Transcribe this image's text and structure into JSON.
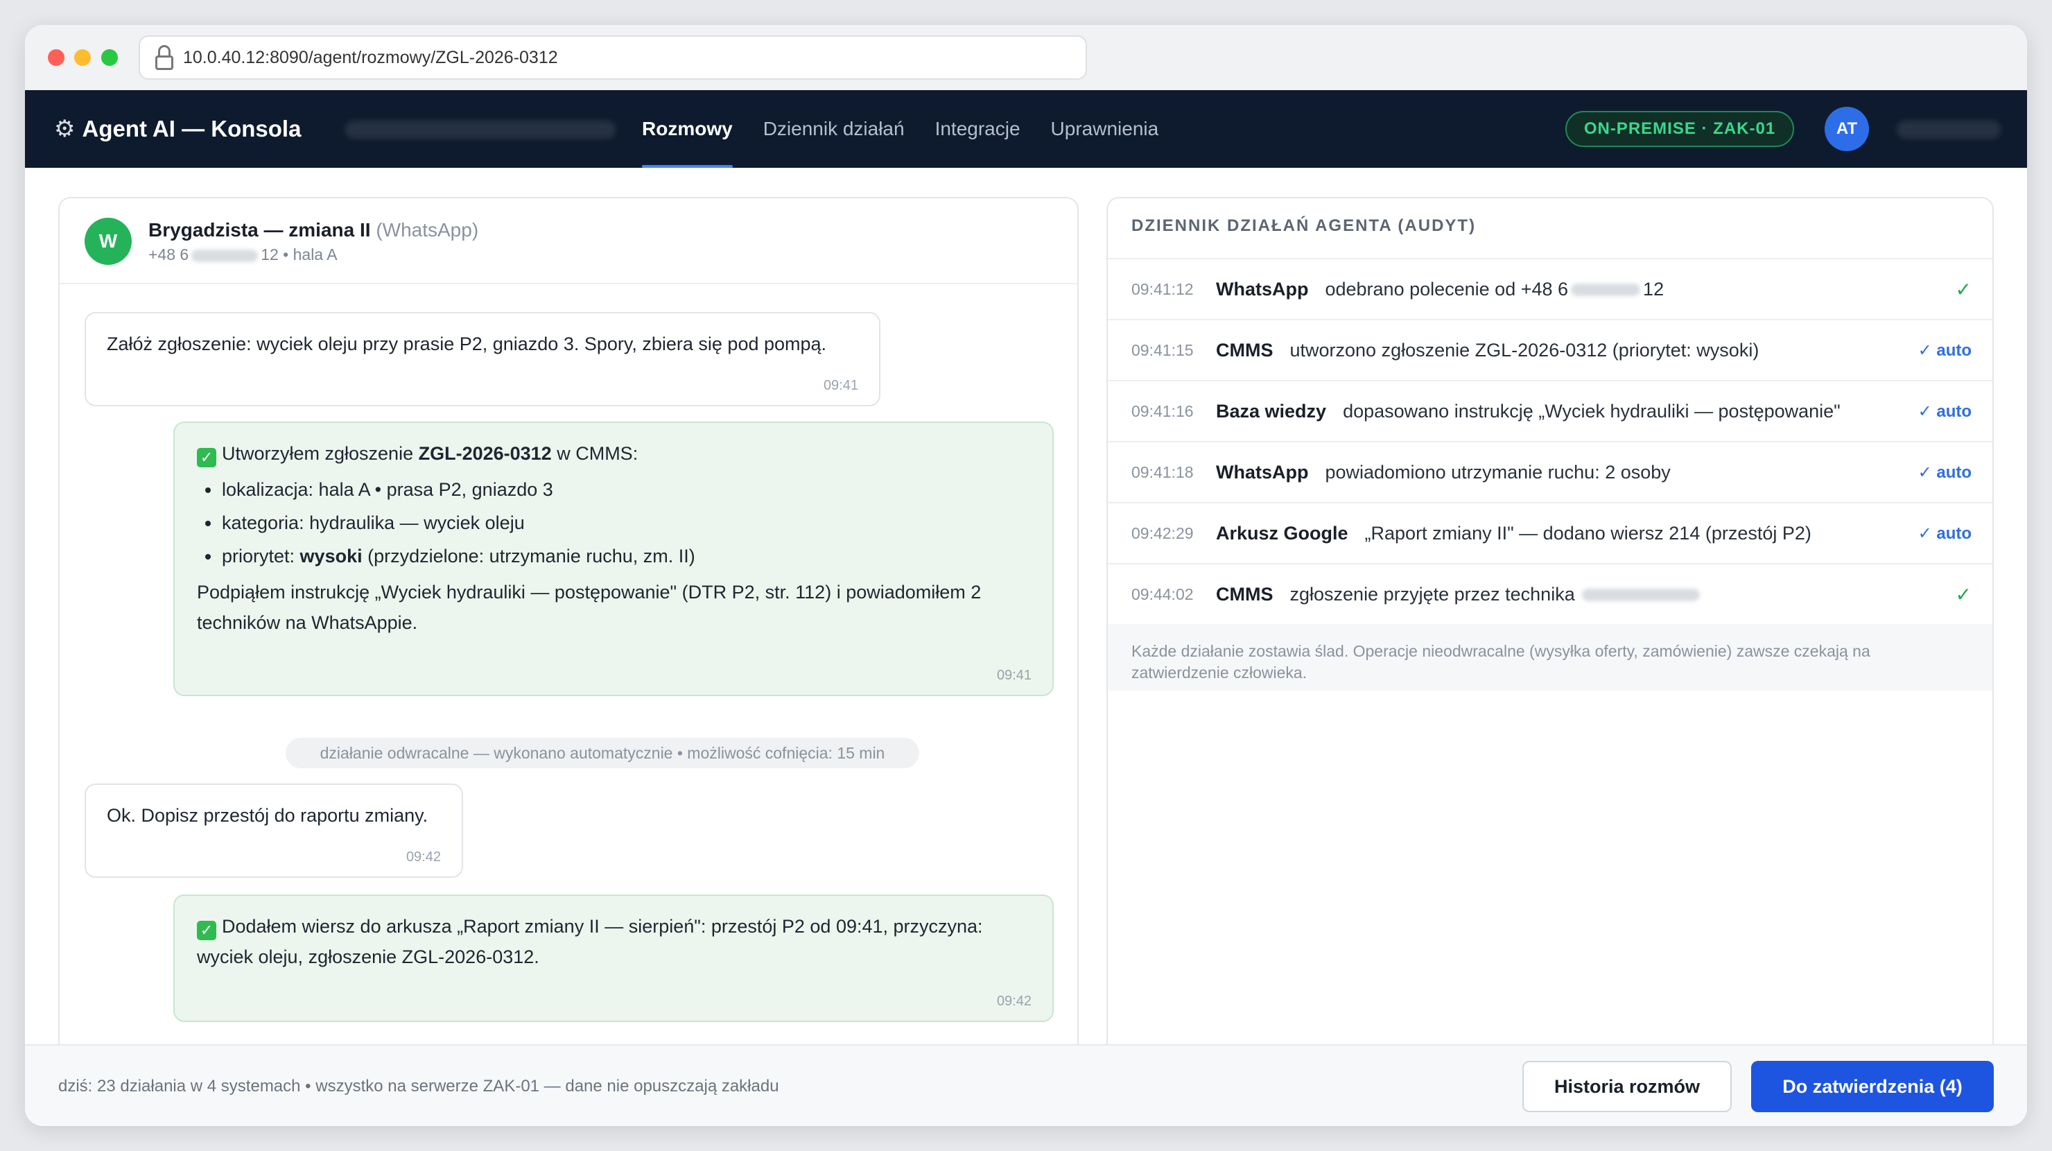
{
  "browser": {
    "url": "10.0.40.12:8090/agent/rozmowy/ZGL-2026-0312"
  },
  "header": {
    "title": "Agent AI — Konsola",
    "nav": [
      "Rozmowy",
      "Dziennik działań",
      "Integracje",
      "Uprawnienia"
    ],
    "active_nav": "Rozmowy",
    "env_badge": "ON-PREMISE · ZAK-01",
    "avatar_initials": "AT"
  },
  "chat": {
    "avatar_letter": "W",
    "contact_name": "Brygadzista — zmiana II",
    "contact_source": "(WhatsApp)",
    "contact_phone_prefix": "+48 6",
    "contact_phone_suffix": "12 • hala A",
    "messages": [
      {
        "text": "Załóż zgłoszenie: wyciek oleju przy prasie P2, gniazdo 3. Spory, zbiera się pod pompą.",
        "time": "09:41"
      },
      {
        "intro_before": "Utworzyłem zgłoszenie ",
        "intro_bold": "ZGL-2026-0312",
        "intro_after": " w CMMS:",
        "bullet1": "lokalizacja: hala A • prasa P2, gniazdo 3",
        "bullet2": "kategoria: hydraulika — wyciek oleju",
        "bullet3_before": "priorytet: ",
        "bullet3_bold": "wysoki",
        "bullet3_after": " (przydzielone: utrzymanie ruchu, zm. II)",
        "closing": "Podpiąłem instrukcję „Wyciek hydrauliki — postępowanie\" (DTR P2, str. 112) i powiadomiłem 2 techników na WhatsAppie.",
        "time": "09:41"
      },
      {
        "text": "Ok. Dopisz przestój do raportu zmiany.",
        "time": "09:42"
      },
      {
        "text": "Dodałem wiersz do arkusza „Raport zmiany II — sierpień\": przestój P2 od 09:41, przyczyna: wyciek oleju, zgłoszenie ZGL-2026-0312.",
        "time": "09:42"
      }
    ],
    "system_note": "działanie odwracalne — wykonano automatycznie • możliwość cofnięcia: 15 min"
  },
  "audit": {
    "title": "DZIENNIK DZIAŁAŃ AGENTA (AUDYT)",
    "rows": [
      {
        "time": "09:41:12",
        "system": "WhatsApp",
        "desc_before": "odebrano polecenie od +48 6",
        "desc_after": "12",
        "status": "✓",
        "status_type": "ok"
      },
      {
        "time": "09:41:15",
        "system": "CMMS",
        "desc": "utworzono zgłoszenie ZGL-2026-0312 (priorytet: wysoki)",
        "status": "✓ auto",
        "status_type": "auto"
      },
      {
        "time": "09:41:16",
        "system": "Baza wiedzy",
        "desc": "dopasowano instrukcję „Wyciek hydrauliki — postępowanie\"",
        "status": "✓ auto",
        "status_type": "auto"
      },
      {
        "time": "09:41:18",
        "system": "WhatsApp",
        "desc": "powiadomiono utrzymanie ruchu: 2 osoby",
        "status": "✓ auto",
        "status_type": "auto"
      },
      {
        "time": "09:42:29",
        "system": "Arkusz Google",
        "desc": "„Raport zmiany II\" — dodano wiersz 214 (przestój P2)",
        "status": "✓ auto",
        "status_type": "auto"
      },
      {
        "time": "09:44:02",
        "system": "CMMS",
        "desc": "zgłoszenie przyjęte przez technika",
        "status": "✓",
        "status_type": "ok"
      }
    ],
    "note": "Każde działanie zostawia ślad. Operacje nieodwracalne (wysyłka oferty, zamówienie) zawsze czekają na zatwierdzenie człowieka."
  },
  "footer": {
    "summary": "dziś: 23 działania w 4 systemach • wszystko na serwerze ZAK-01 — dane nie opuszczają zakładu",
    "history_button": "Historia rozmów",
    "approve_button": "Do zatwierdzenia (4)"
  },
  "colors": {
    "header_bg": "#0e1b2e",
    "accent": "#1d55e0",
    "agent_bubble": "#ecf6ee",
    "ok_green": "#22a84a",
    "auto_blue": "#2f6fe0"
  }
}
